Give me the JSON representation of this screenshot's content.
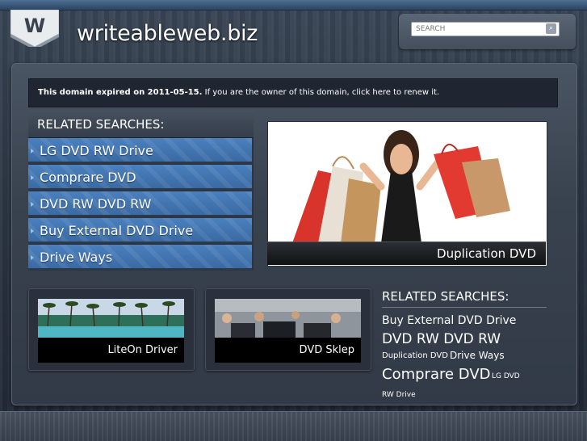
{
  "logo": {
    "letter": "W"
  },
  "site": {
    "title": "writeableweb.biz"
  },
  "search": {
    "placeholder": "SEARCH",
    "button_icon": "magnifier-icon"
  },
  "notice": {
    "bold": "This domain expired on 2011-05-15.",
    "rest": " If you are the owner of this domain, click here to renew it."
  },
  "related": {
    "heading": "RELATED SEARCHES:",
    "items": [
      {
        "label": "LG DVD RW Drive"
      },
      {
        "label": "Comprare DVD"
      },
      {
        "label": "DVD RW DVD RW"
      },
      {
        "label": "Buy External DVD Drive"
      },
      {
        "label": "Drive Ways"
      }
    ]
  },
  "feature": {
    "caption": "Duplication DVD"
  },
  "thumbs": [
    {
      "caption": "LiteOn Driver"
    },
    {
      "caption": "DVD Sklep"
    }
  ],
  "side": {
    "heading": "RELATED SEARCHES:",
    "links": [
      {
        "label": "Buy External DVD Drive"
      },
      {
        "label": "DVD RW DVD RW"
      },
      {
        "label": "Duplication DVD"
      },
      {
        "label": "Drive Ways"
      },
      {
        "label": "Comprare DVD"
      },
      {
        "label": "LG DVD"
      },
      {
        "label": "RW Drive"
      }
    ]
  },
  "colors": {
    "accent_blue": "#4179b8",
    "dark_panel": "#1f2632"
  }
}
